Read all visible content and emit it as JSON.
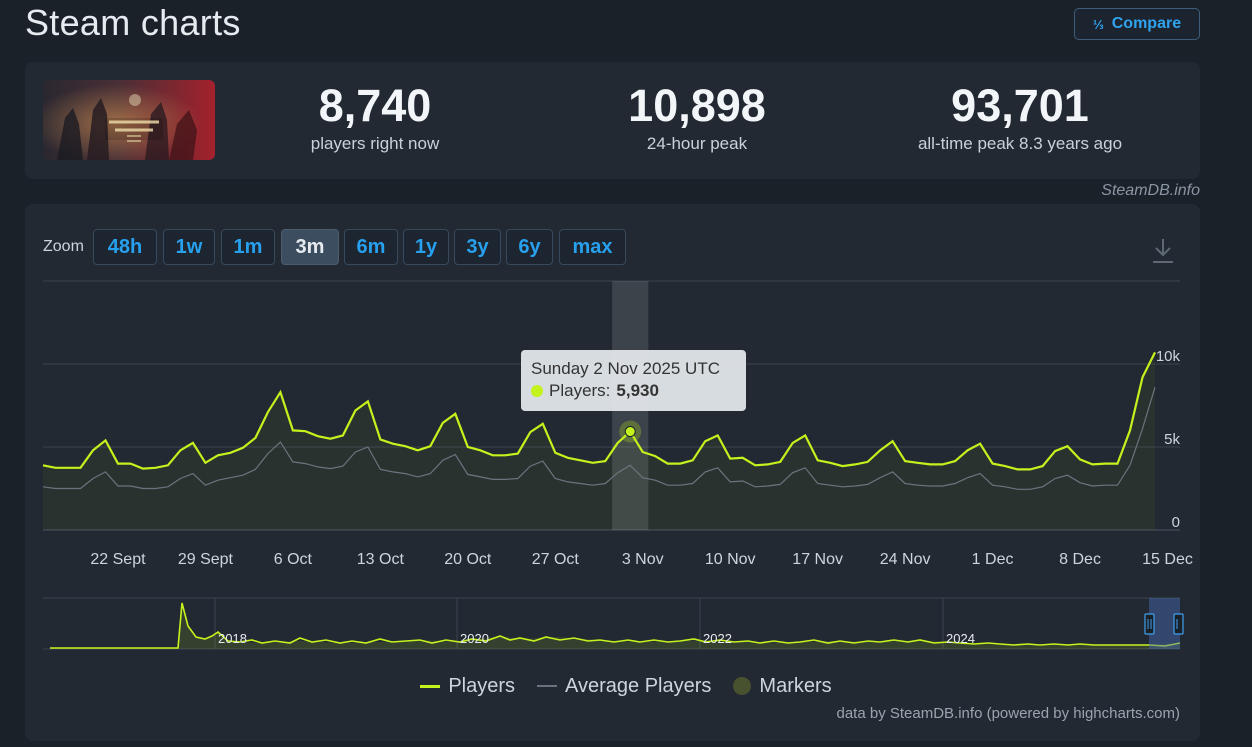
{
  "header": {
    "title": "Steam charts",
    "compare_icon": "⅓",
    "compare_label": "Compare"
  },
  "summary": {
    "stats": [
      {
        "value": "8,740",
        "label": "players right now"
      },
      {
        "value": "10,898",
        "label": "24-hour peak"
      },
      {
        "value": "93,701",
        "label": "all-time peak 8.3 years ago"
      }
    ]
  },
  "credit_top": "SteamDB.info",
  "zoom": {
    "label": "Zoom",
    "options": [
      "48h",
      "1w",
      "1m",
      "3m",
      "6m",
      "1y",
      "3y",
      "6y",
      "max"
    ],
    "active": "3m"
  },
  "tooltip": {
    "date": "Sunday 2 Nov 2025 UTC",
    "series_label": "Players:",
    "value": "5,930"
  },
  "legend": [
    {
      "label": "Players",
      "color": "#c4f21d",
      "shape": "line"
    },
    {
      "label": "Average Players",
      "color": "#6b747e",
      "shape": "line"
    },
    {
      "label": "Markers",
      "color": "#48522f",
      "shape": "dot"
    }
  ],
  "credit_bottom": "data by SteamDB.info (powered by highcharts.com)",
  "colors": {
    "players": "#c4f21d",
    "average": "#6b747e",
    "accent": "#27a0ee",
    "background": "#1b2129",
    "card": "#222932"
  },
  "chart_data": {
    "type": "line",
    "x_ticks": [
      "22 Sept",
      "29 Sept",
      "6 Oct",
      "13 Oct",
      "20 Oct",
      "27 Oct",
      "3 Nov",
      "10 Nov",
      "17 Nov",
      "24 Nov",
      "1 Dec",
      "8 Dec",
      "15 Dec"
    ],
    "y_ticks": [
      "0",
      "5k",
      "10k"
    ],
    "ylim": [
      0,
      15000
    ],
    "x_start": "2025-09-16",
    "x_end": "2025-12-16",
    "highlight_date": "2025-11-02",
    "series": [
      {
        "name": "Players",
        "color": "#c4f21d",
        "values": [
          3900,
          3750,
          3750,
          3750,
          4800,
          5400,
          4000,
          4000,
          3700,
          3750,
          3900,
          4800,
          5250,
          4050,
          4500,
          4650,
          4950,
          5550,
          7100,
          8300,
          6000,
          5950,
          5650,
          5500,
          5700,
          7200,
          7750,
          5450,
          5200,
          5050,
          4800,
          5050,
          6450,
          7000,
          5000,
          4800,
          4500,
          4500,
          4600,
          5900,
          6400,
          4650,
          4350,
          4200,
          4050,
          4150,
          5250,
          5930,
          4700,
          4450,
          4000,
          4000,
          4200,
          5350,
          5700,
          4300,
          4350,
          3900,
          3950,
          4100,
          5250,
          5700,
          4200,
          4050,
          3850,
          3950,
          4100,
          4800,
          5350,
          4150,
          4050,
          3950,
          3950,
          4150,
          4800,
          5200,
          4000,
          3850,
          3650,
          3650,
          3850,
          4750,
          5050,
          4250,
          3950,
          4000,
          4000,
          6000,
          9200,
          10700
        ]
      },
      {
        "name": "Average Players",
        "color": "#6b747e",
        "values": [
          2600,
          2500,
          2500,
          2500,
          3100,
          3500,
          2650,
          2650,
          2500,
          2500,
          2600,
          3100,
          3400,
          2700,
          3000,
          3150,
          3300,
          3650,
          4600,
          5300,
          4100,
          4000,
          3800,
          3700,
          3850,
          4700,
          5000,
          3650,
          3500,
          3400,
          3200,
          3400,
          4200,
          4550,
          3350,
          3200,
          3050,
          3050,
          3100,
          3850,
          4150,
          3100,
          2900,
          2800,
          2700,
          2800,
          3450,
          3900,
          3150,
          3000,
          2700,
          2700,
          2800,
          3500,
          3750,
          2900,
          2950,
          2600,
          2650,
          2750,
          3450,
          3750,
          2800,
          2700,
          2600,
          2650,
          2750,
          3150,
          3500,
          2800,
          2700,
          2650,
          2650,
          2800,
          3150,
          3400,
          2700,
          2600,
          2450,
          2450,
          2600,
          3100,
          3300,
          2850,
          2650,
          2700,
          2700,
          3900,
          6100,
          8600
        ]
      }
    ],
    "navigator": {
      "year_labels": [
        "2018",
        "2020",
        "2022",
        "2024"
      ]
    }
  }
}
